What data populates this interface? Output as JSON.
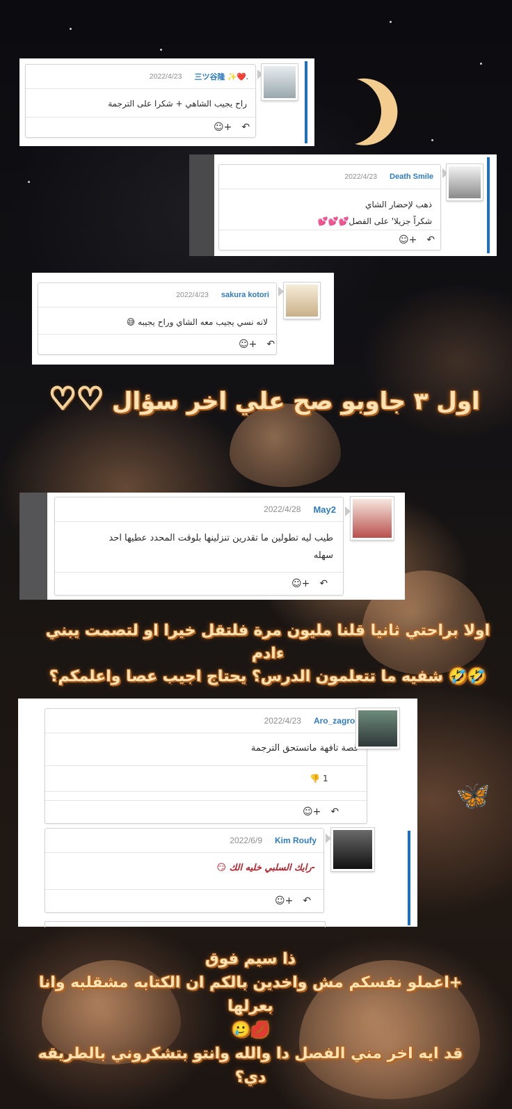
{
  "comments": [
    {
      "user": "三ツ谷隆 ✨❤️.",
      "date": "2022/4/23",
      "text": "راح يجيب الشاهي + شكرا على الترجمة"
    },
    {
      "user": "Death Smile",
      "date": "2022/4/23",
      "line1": "ذهب لإحضار الشاي",
      "line2": "شكراً جزيلا' على الفصل💕💕💕"
    },
    {
      "user": "sakura kotori",
      "date": "2022/4/23",
      "text": "لانه نسي يجيب معه الشاي وراح يجيبه 😅"
    },
    {
      "user": "May2",
      "date": "2022/4/28",
      "line1": "طيب ليه تطولين ما تقدرين تنزلينها بلوقت المحدد عطيها احد",
      "line2": "سهله"
    },
    {
      "user": "Aro_zagros",
      "date": "2022/4/23",
      "text": "قصة تافهة ماتستحق الترجمة",
      "dislikes": "1"
    },
    {
      "user": "Kim Roufy",
      "date": "2022/6/9",
      "text": "-رايك السلبي خليه الك 😏"
    }
  ],
  "reactions": {
    "reply_icon": "reply-arrow-icon",
    "emoji_icon": "add-emoji-icon",
    "emoji_plus": "+"
  },
  "captions": {
    "c1": "اول ٣ جاوبو صح علي اخر سؤال",
    "c1_hearts": "♡♡",
    "c2_l1": "اولا براحتي ثانيا قلنا مليون مرة فلتقل خيرا او لتصمت يبني ءادم",
    "c2_l2": "🤣🤣 شفيه ما تتعلمون الدرس؟ يحتاج اجيب عصا واعلمكم؟",
    "c3_l1": "ذا سيم فوق",
    "c3_l2": "+اعملو نفسكم مش واخدين بالكم ان الكتابه مشقلبه وانا بعرلها",
    "c3_l3": "💋🥲",
    "c3_l4": "قد ايه اخر مني الفصل دا والله وانتو بتشكروني بالطريقه دي؟"
  }
}
